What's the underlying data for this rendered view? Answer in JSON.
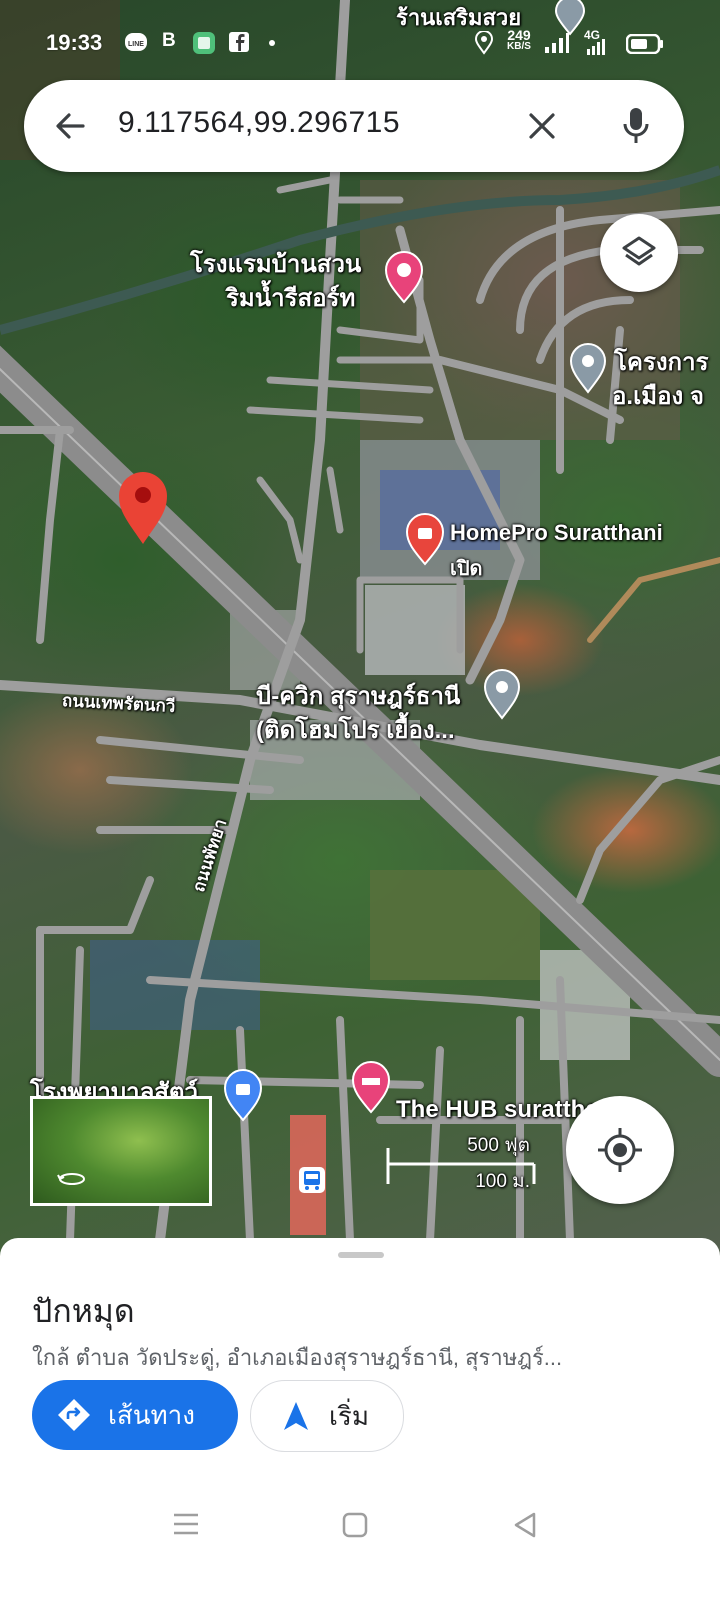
{
  "status_bar": {
    "time": "19:33",
    "notification_icons": [
      "line-icon",
      "bold-b-icon",
      "green-app-icon",
      "facebook-icon",
      "dot-icon"
    ],
    "b_label": "B",
    "net_speed_value": "249",
    "net_speed_unit": "KB/S",
    "network_label": "4G",
    "status_icons": [
      "location-icon",
      "signal-icon",
      "battery-icon"
    ]
  },
  "search": {
    "query": "9.117564,99.296715",
    "back_icon": "arrow-left-icon",
    "clear_icon": "close-icon",
    "voice_icon": "microphone-icon"
  },
  "map": {
    "labels": {
      "top_shop": "ร้านเสริมสวย",
      "hotel_line1": "โรงแรมบ้านสวน",
      "hotel_line2": "ริมน้ำรีสอร์ท",
      "project_line1": "โครงการ",
      "project_line2": "อ.เมือง จ",
      "homepro": "HomePro Suratthani",
      "homepro_status": "เปิด",
      "bquik_line1": "บี-ควิก สุราษฎร์ธานี",
      "bquik_line2": "(ติดโฮมโปร เยื้อง...",
      "road_1": "ถนนเทพรัตนกวี",
      "road_2": "ถนนพัทยา",
      "vet_hospital": "โรงพยาบาลสัตว์",
      "hub": "The HUB suratthani"
    },
    "scale": {
      "imperial": "500 ฟุต",
      "metric": "100 ม."
    },
    "colors": {
      "dropped_pin": "#ea4335",
      "hotel_pin": "#e8437a",
      "shop_pin": "#e8453c",
      "gray_pin": "#8a9aa6",
      "road": "#9e9e9e",
      "accent_blue": "#1a73e8"
    }
  },
  "layers_icon": "layers-icon",
  "locate_icon": "my-location-icon",
  "street_view_icon": "360-rotate-icon",
  "bottom_sheet": {
    "title": "ปักหมุด",
    "address": "ใกล้ ตำบล วัดประดู่, อำเภอเมืองสุราษฎร์ธานี, สุราษฎร์...",
    "directions_label": "เส้นทาง",
    "start_label": "เริ่ม",
    "directions_icon": "directions-icon",
    "start_icon": "navigation-arrow-icon"
  },
  "nav_bar": {
    "icons": [
      "menu-icon",
      "home-square-icon",
      "back-triangle-icon"
    ]
  }
}
